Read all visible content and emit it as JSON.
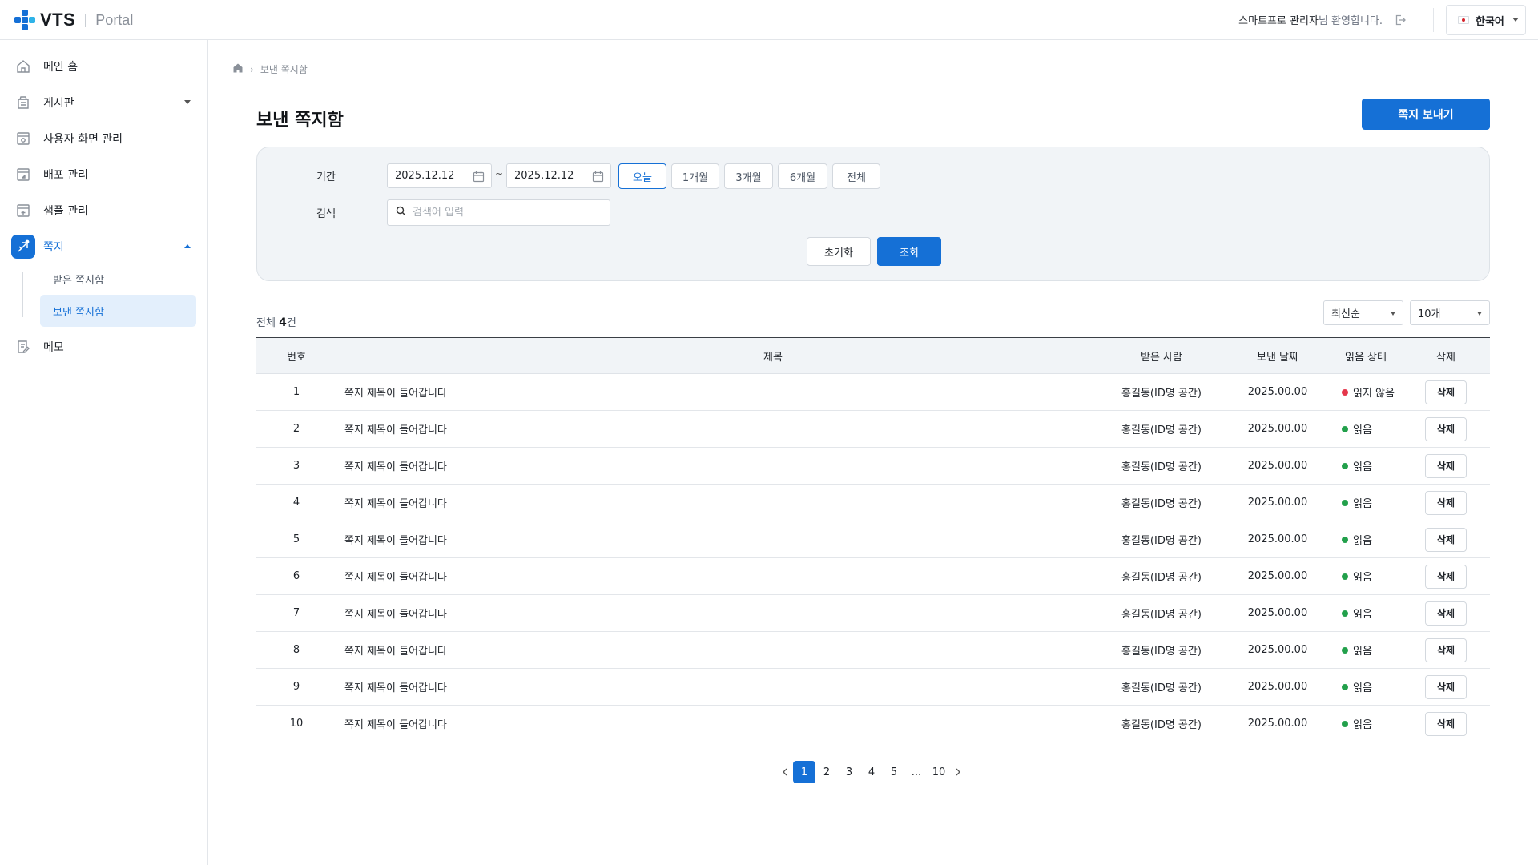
{
  "header": {
    "logo_text": "VTS",
    "logo_sub": "Portal",
    "welcome_name": "스마트프로 관리자",
    "welcome_suffix": "님 환영합니다.",
    "language": "한국어"
  },
  "sidebar": {
    "items": [
      {
        "label": "메인 홈",
        "icon": "home-icon"
      },
      {
        "label": "게시판",
        "icon": "board-icon",
        "expandable": true
      },
      {
        "label": "사용자 화면 관리",
        "icon": "screen-settings-icon"
      },
      {
        "label": "배포 관리",
        "icon": "deploy-icon"
      },
      {
        "label": "샘플 관리",
        "icon": "sample-icon"
      },
      {
        "label": "쪽지",
        "icon": "message-icon",
        "expanded": true,
        "active": true
      },
      {
        "label": "메모",
        "icon": "memo-icon"
      }
    ],
    "sub_items": [
      {
        "label": "받은 쪽지함"
      },
      {
        "label": "보낸 쪽지함",
        "active": true
      }
    ]
  },
  "breadcrumb": {
    "current": "보낸 쪽지함"
  },
  "page": {
    "title": "보낸 쪽지함",
    "send_button": "쪽지 보내기"
  },
  "filter": {
    "period_label": "기간",
    "start_date": "2025.12.12",
    "end_date": "2025.12.12",
    "tilde": "~",
    "ranges": [
      "오늘",
      "1개월",
      "3개월",
      "6개월",
      "전체"
    ],
    "active_range": "오늘",
    "search_label": "검색",
    "search_placeholder": "검색어 입력",
    "reset_button": "초기화",
    "query_button": "조회"
  },
  "list": {
    "total_prefix": "전체 ",
    "total_count": "4",
    "total_suffix": "건",
    "sort_select": "최신순",
    "page_size_select": "10개"
  },
  "table": {
    "headers": {
      "no": "번호",
      "title": "제목",
      "recipient": "받은 사람",
      "sent_date": "보낸 날짜",
      "read_status": "읽음 상태",
      "delete": "삭제"
    },
    "rows": [
      {
        "no": "1",
        "title": "쪽지 제목이 들어갑니다",
        "recipient": "홍길동(ID명 공간)",
        "date": "2025.00.00",
        "status": "읽지 않음",
        "status_color": "#e5364b",
        "delete": "삭제"
      },
      {
        "no": "2",
        "title": "쪽지 제목이 들어갑니다",
        "recipient": "홍길동(ID명 공간)",
        "date": "2025.00.00",
        "status": "읽음",
        "status_color": "#22a04b",
        "delete": "삭제"
      },
      {
        "no": "3",
        "title": "쪽지 제목이 들어갑니다",
        "recipient": "홍길동(ID명 공간)",
        "date": "2025.00.00",
        "status": "읽음",
        "status_color": "#22a04b",
        "delete": "삭제"
      },
      {
        "no": "4",
        "title": "쪽지 제목이 들어갑니다",
        "recipient": "홍길동(ID명 공간)",
        "date": "2025.00.00",
        "status": "읽음",
        "status_color": "#22a04b",
        "delete": "삭제"
      },
      {
        "no": "5",
        "title": "쪽지 제목이 들어갑니다",
        "recipient": "홍길동(ID명 공간)",
        "date": "2025.00.00",
        "status": "읽음",
        "status_color": "#22a04b",
        "delete": "삭제"
      },
      {
        "no": "6",
        "title": "쪽지 제목이 들어갑니다",
        "recipient": "홍길동(ID명 공간)",
        "date": "2025.00.00",
        "status": "읽음",
        "status_color": "#22a04b",
        "delete": "삭제"
      },
      {
        "no": "7",
        "title": "쪽지 제목이 들어갑니다",
        "recipient": "홍길동(ID명 공간)",
        "date": "2025.00.00",
        "status": "읽음",
        "status_color": "#22a04b",
        "delete": "삭제"
      },
      {
        "no": "8",
        "title": "쪽지 제목이 들어갑니다",
        "recipient": "홍길동(ID명 공간)",
        "date": "2025.00.00",
        "status": "읽음",
        "status_color": "#22a04b",
        "delete": "삭제"
      },
      {
        "no": "9",
        "title": "쪽지 제목이 들어갑니다",
        "recipient": "홍길동(ID명 공간)",
        "date": "2025.00.00",
        "status": "읽음",
        "status_color": "#22a04b",
        "delete": "삭제"
      },
      {
        "no": "10",
        "title": "쪽지 제목이 들어갑니다",
        "recipient": "홍길동(ID명 공간)",
        "date": "2025.00.00",
        "status": "읽음",
        "status_color": "#22a04b",
        "delete": "삭제"
      }
    ]
  },
  "pagination": {
    "pages": [
      "1",
      "2",
      "3",
      "4",
      "5",
      "...",
      "10"
    ],
    "current": "1"
  },
  "colors": {
    "accent": "#1570d6",
    "unread": "#e5364b",
    "read": "#22a04b"
  }
}
